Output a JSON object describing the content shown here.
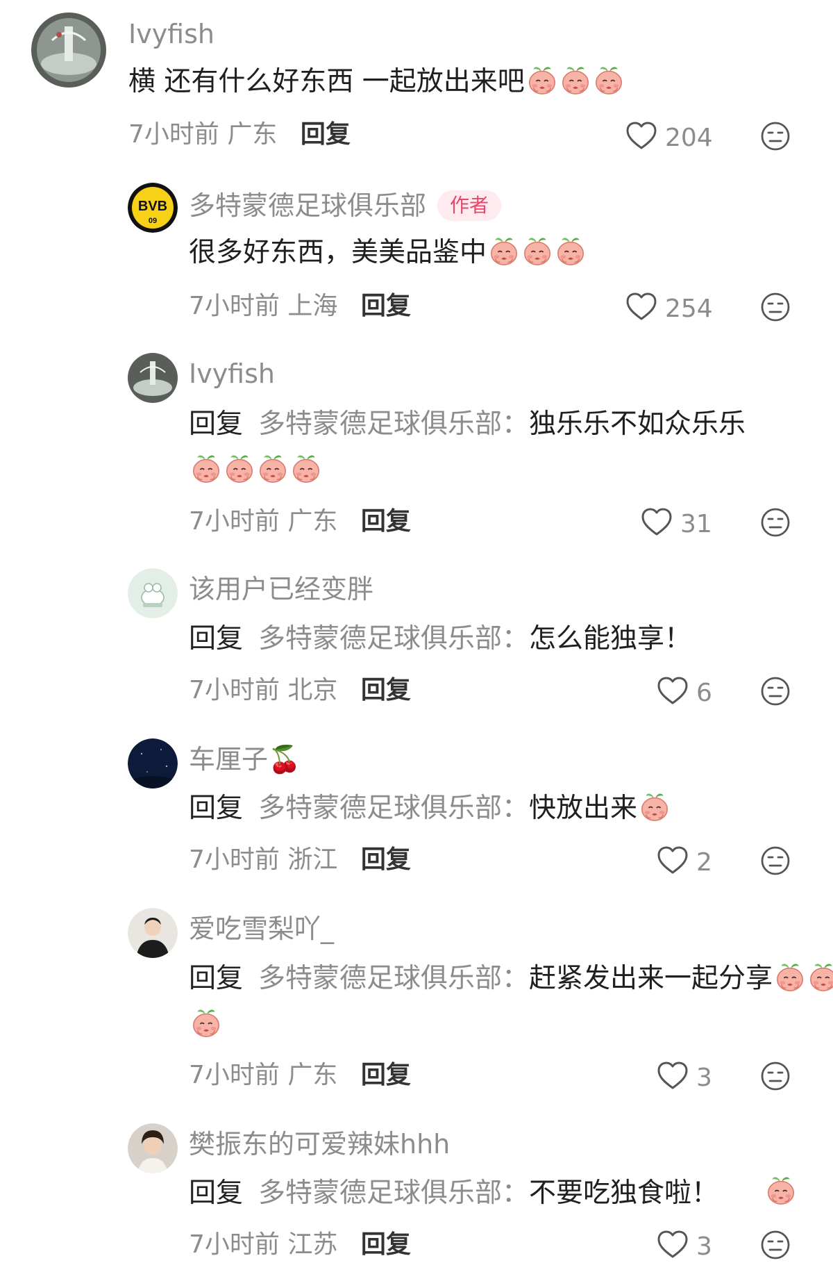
{
  "comments": [
    {
      "username": "Ivyfish",
      "text": "横 还有什么好东西 一起放出来吧",
      "emoji_count": 3,
      "time": "7小时前",
      "location": "广东",
      "reply_label": "回复",
      "likes": "204"
    },
    {
      "username": "多特蒙德足球俱乐部",
      "badge": "作者",
      "text": "很多好东西，美美品鉴中",
      "emoji_count": 3,
      "time": "7小时前",
      "location": "上海",
      "reply_label": "回复",
      "likes": "254"
    },
    {
      "username": "Ivyfish",
      "reply_prefix": "回复",
      "reply_to": "多特蒙德足球俱乐部：",
      "text": "独乐乐不如众乐乐",
      "emoji_count": 4,
      "time": "7小时前",
      "location": "广东",
      "reply_label": "回复",
      "likes": "31"
    },
    {
      "username": "该用户已经变胖",
      "reply_prefix": "回复",
      "reply_to": "多特蒙德足球俱乐部：",
      "text": "怎么能独享！",
      "emoji_count": 0,
      "time": "7小时前",
      "location": "北京",
      "reply_label": "回复",
      "likes": "6"
    },
    {
      "username": "车厘子🍒",
      "reply_prefix": "回复",
      "reply_to": "多特蒙德足球俱乐部：",
      "text": "快放出来",
      "emoji_count": 1,
      "time": "7小时前",
      "location": "浙江",
      "reply_label": "回复",
      "likes": "2"
    },
    {
      "username": "爱吃雪梨吖_",
      "reply_prefix": "回复",
      "reply_to": "多特蒙德足球俱乐部：",
      "text": "赶紧发出来一起分享",
      "emoji_count": 3,
      "time": "7小时前",
      "location": "广东",
      "reply_label": "回复",
      "likes": "3"
    },
    {
      "username": "樊振东的可爱辣妹hhh",
      "reply_prefix": "回复",
      "reply_to": "多特蒙德足球俱乐部：",
      "text": "不要吃独食啦！",
      "emoji_count": 1,
      "time": "7小时前",
      "location": "江苏",
      "reply_label": "回复",
      "likes": "3"
    }
  ],
  "icons": {
    "like": "heart-outline-icon",
    "dislike": "neutral-face-icon",
    "emoji": "peach-face-emoji"
  },
  "colors": {
    "author_badge_bg": "#fdebef",
    "author_badge_text": "#e8456b",
    "muted_text": "#8c8c8c"
  }
}
